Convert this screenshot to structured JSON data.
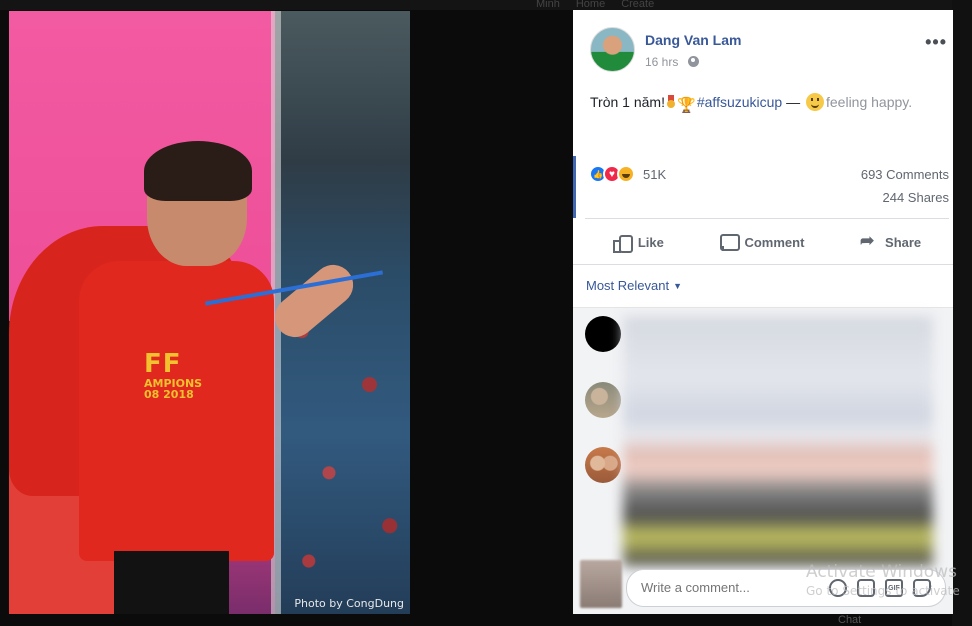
{
  "background": {
    "nav_items": [
      "Minh",
      "Home",
      "Create"
    ],
    "chat_label": "Chat"
  },
  "photo": {
    "credit": "Photo by CongDung",
    "jersey_big": "FF",
    "jersey_small": "AMPIONS",
    "jersey_years": "08 2018"
  },
  "post": {
    "author": "Dang Van Lam",
    "time": "16 hrs",
    "privacy_icon": "globe-icon",
    "more_label": "•••",
    "text_prefix": "Tròn 1 năm!",
    "hashtag": "#affsuzukicup",
    "separator": "—",
    "feeling": "feeling happy."
  },
  "stats": {
    "reaction_count": "51K",
    "reactions": [
      "like",
      "love",
      "haha"
    ],
    "comments": "693 Comments",
    "shares": "244 Shares"
  },
  "actions": {
    "like": "Like",
    "comment": "Comment",
    "share": "Share"
  },
  "comments_section": {
    "sort_label": "Most Relevant",
    "write_placeholder": "Write a comment...",
    "input_icons": [
      "emoji-icon",
      "camera-icon",
      "gif-icon",
      "sticker-icon"
    ],
    "gif_label": "GIF"
  },
  "watermark": {
    "line1": "Activate Windows",
    "line2": "Go to Settings to activate"
  },
  "colors": {
    "link": "#385898",
    "muted": "#90949c",
    "accent": "#4267b2"
  }
}
